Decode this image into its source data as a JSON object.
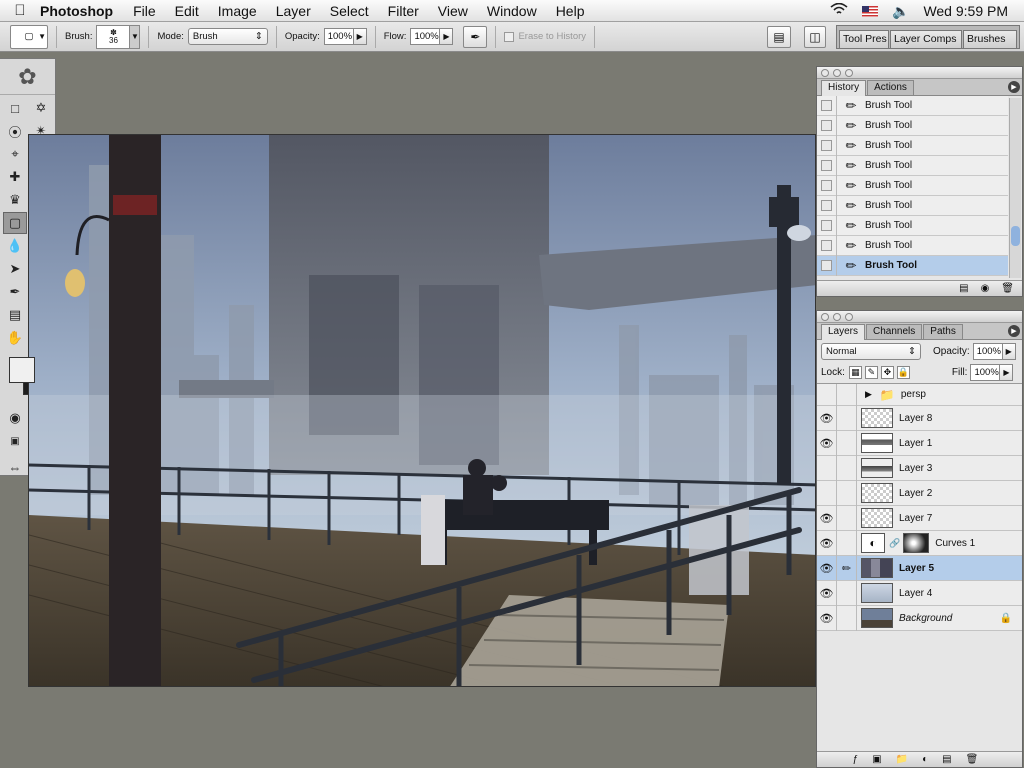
{
  "menubar": {
    "app": "Photoshop",
    "items": [
      "File",
      "Edit",
      "Image",
      "Layer",
      "Select",
      "Filter",
      "View",
      "Window",
      "Help"
    ],
    "clock": "Wed 9:59 PM",
    "icons": [
      "apple-icon",
      "wifi-icon",
      "flag-icon",
      "volume-icon"
    ]
  },
  "options": {
    "brush_label": "Brush:",
    "brush_size": "36",
    "mode_label": "Mode:",
    "mode_value": "Brush",
    "opacity_label": "Opacity:",
    "opacity_value": "100%",
    "flow_label": "Flow:",
    "flow_value": "100%",
    "erase_history": "Erase to History",
    "well_tabs": [
      "Tool Pres",
      "Layer Comps",
      "Brushes"
    ]
  },
  "history": {
    "tabs": [
      "History",
      "Actions"
    ],
    "items": [
      "Brush Tool",
      "Brush Tool",
      "Brush Tool",
      "Brush Tool",
      "Brush Tool",
      "Brush Tool",
      "Brush Tool",
      "Brush Tool",
      "Brush Tool"
    ],
    "selected_index": 8
  },
  "layers": {
    "tabs": [
      "Layers",
      "Channels",
      "Paths"
    ],
    "blend_mode": "Normal",
    "opacity_label": "Opacity:",
    "opacity_value": "100%",
    "lock_label": "Lock:",
    "fill_label": "Fill:",
    "fill_value": "100%",
    "group_name": "persp",
    "items": [
      {
        "name": "Layer 8",
        "visible": true
      },
      {
        "name": "Layer 1",
        "visible": true
      },
      {
        "name": "Layer 3",
        "visible": false
      },
      {
        "name": "Layer 2",
        "visible": false
      },
      {
        "name": "Layer 7",
        "visible": true
      },
      {
        "name": "Curves 1",
        "visible": true
      },
      {
        "name": "Layer 5",
        "visible": true
      },
      {
        "name": "Layer 4",
        "visible": true
      },
      {
        "name": "Background",
        "visible": true
      }
    ],
    "selected": "Layer 5"
  },
  "colors": {
    "foreground": "#f0f0f0",
    "background": "#1e1e1e",
    "selection": "#b4cdea"
  }
}
